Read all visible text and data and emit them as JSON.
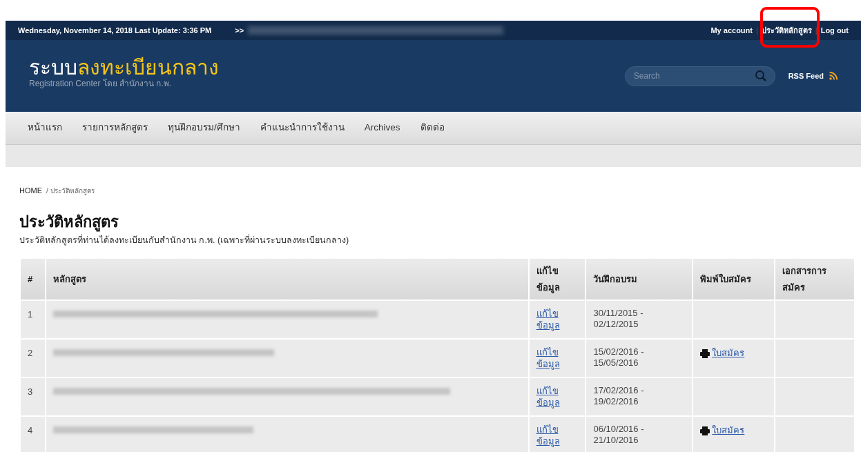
{
  "top_bar": {
    "date_text": "Wednesday, November 14, 2018 Last Update: 3:36 PM",
    "ticker_prefix": ">>",
    "links": [
      "My account",
      "ประวัติหลักสูตร",
      "Log out"
    ],
    "separator": "|"
  },
  "header": {
    "logo_part1": "ระบบ",
    "logo_part2": "ลงทะเบียนกลาง",
    "tagline": "Registration Center โดย สำนักงาน ก.พ.",
    "search": {
      "placeholder": "Search"
    },
    "rss_label": "RSS Feed"
  },
  "nav": {
    "items": [
      "หน้าแรก",
      "รายการหลักสูตร",
      "ทุนฝึกอบรม/ศึกษา",
      "คำแนะนำการใช้งาน",
      "Archives",
      "ติดต่อ"
    ]
  },
  "breadcrumb": {
    "home": "HOME",
    "current": "/ ประวัติหลักสูตร"
  },
  "page": {
    "title": "ประวัติหลักสูตร",
    "subtitle": "ประวัติหลักสูตรที่ท่านได้ลงทะเบียนกับสำนักงาน ก.พ. (เฉพาะที่ผ่านระบบลงทะเบียนกลาง)"
  },
  "table": {
    "columns": [
      "#",
      "หลักสูตร",
      "แก้ไข ข้อมูล",
      "วันฝึกอบรม",
      "พิมพ์ใบสมัคร",
      "เอกสารการ สมัคร"
    ],
    "rows": [
      {
        "number": "1",
        "edit_link": "แก้ไข ข้อมูล",
        "dates": "30/11/2015 - 02/12/2015"
      },
      {
        "number": "2",
        "edit_link": "แก้ไข ข้อมูล",
        "dates": "15/02/2016 - 15/05/2016",
        "print_link": "ใบสมัคร"
      },
      {
        "number": "3",
        "edit_link": "แก้ไข ข้อมูล",
        "dates": "17/02/2016 - 19/02/2016"
      },
      {
        "number": "4",
        "edit_link": "แก้ไข ข้อมูล",
        "dates": "06/10/2016 - 21/10/2016",
        "print_link": "ใบสมัคร"
      }
    ]
  }
}
